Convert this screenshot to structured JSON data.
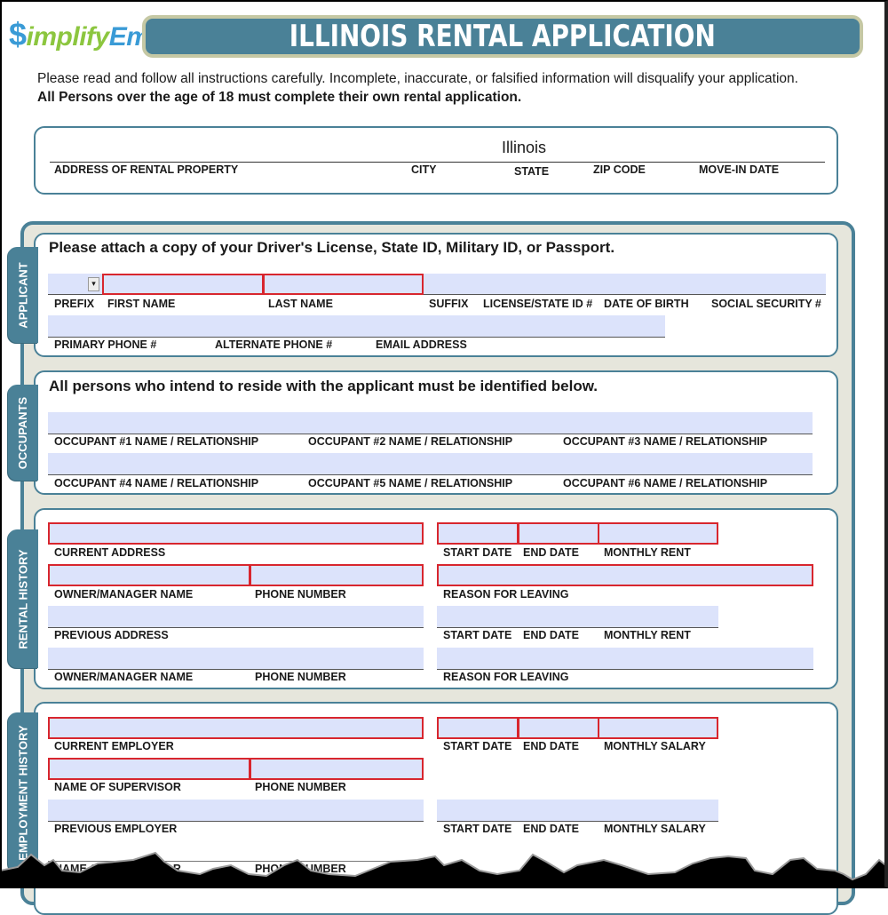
{
  "header": {
    "logo": {
      "dollar": "$",
      "part1": "implify",
      "part2": "Em"
    },
    "title": "ILLINOIS RENTAL APPLICATION",
    "intro_line1": "Please read and follow all instructions carefully. Incomplete, inaccurate, or falsified information will disqualify your application.",
    "intro_line2": "All Persons over the age of 18 must complete their own rental application."
  },
  "property": {
    "state_value": "Illinois",
    "labels": {
      "address": "ADDRESS OF RENTAL PROPERTY",
      "city": "CITY",
      "state": "STATE",
      "zip": "ZIP CODE",
      "move_in": "MOVE-IN DATE"
    }
  },
  "applicant": {
    "tab": "APPLICANT",
    "heading": "Please attach a copy of your Driver's License, State ID, Military ID, or Passport.",
    "prefix_dropdown_icon": "▾",
    "labels": {
      "prefix": "PREFIX",
      "first_name": "FIRST NAME",
      "last_name": "LAST NAME",
      "suffix": "SUFFIX",
      "license": "LICENSE/STATE ID #",
      "dob": "DATE OF BIRTH",
      "ssn": "SOCIAL SECURITY #",
      "primary_phone": "PRIMARY PHONE #",
      "alternate_phone": "ALTERNATE PHONE #",
      "email": "EMAIL ADDRESS"
    }
  },
  "occupants": {
    "tab": "OCCUPANTS",
    "heading": "All persons who intend to reside with the applicant must be identified below.",
    "labels": [
      "OCCUPANT #1 NAME / RELATIONSHIP",
      "OCCUPANT #2 NAME / RELATIONSHIP",
      "OCCUPANT #3 NAME / RELATIONSHIP",
      "OCCUPANT #4 NAME / RELATIONSHIP",
      "OCCUPANT #5 NAME / RELATIONSHIP",
      "OCCUPANT #6 NAME / RELATIONSHIP"
    ]
  },
  "rental_history": {
    "tab": "RENTAL HISTORY",
    "labels": {
      "current_address": "CURRENT ADDRESS",
      "start_date": "START DATE",
      "end_date": "END DATE",
      "monthly_rent": "MONTHLY RENT",
      "owner_manager": "OWNER/MANAGER NAME",
      "phone": "PHONE NUMBER",
      "reason": "REASON FOR LEAVING",
      "previous_address": "PREVIOUS ADDRESS"
    }
  },
  "employment_history": {
    "tab": "EMPLOYMENT HISTORY",
    "labels": {
      "current_employer": "CURRENT EMPLOYER",
      "start_date": "START DATE",
      "end_date": "END DATE",
      "monthly_salary": "MONTHLY SALARY",
      "supervisor": "NAME OF SUPERVISOR",
      "phone": "PHONE NUMBER",
      "previous_employer": "PREVIOUS EMPLOYER",
      "supervisor_cut": "NAME OF SUPERVISOR"
    }
  },
  "colors": {
    "brand_teal": "#4a8197",
    "field_fill": "#dce3fb",
    "required_border": "#d8262e",
    "logo_green": "#8cc63f",
    "logo_blue": "#3a9bd6"
  }
}
